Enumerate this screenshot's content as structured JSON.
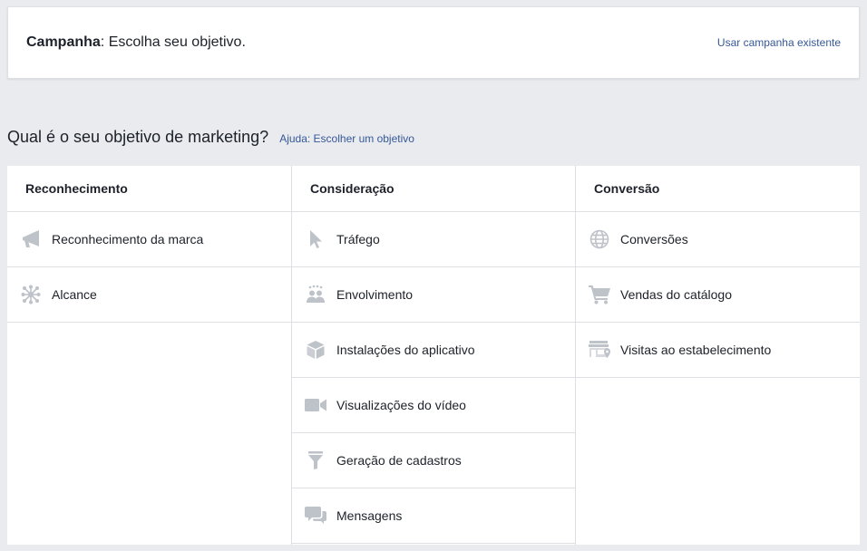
{
  "header": {
    "title_bold": "Campanha",
    "title_rest": ": Escolha seu objetivo.",
    "use_existing_link": "Usar campanha existente"
  },
  "question": {
    "text": "Qual é o seu objetivo de marketing?",
    "help_link": "Ajuda: Escolher um objetivo"
  },
  "icon_color": "#bec2c9",
  "columns": [
    {
      "title": "Reconhecimento",
      "items": [
        {
          "label": "Reconhecimento da marca",
          "icon": "megaphone-icon"
        },
        {
          "label": "Alcance",
          "icon": "reach-icon"
        }
      ]
    },
    {
      "title": "Consideração",
      "items": [
        {
          "label": "Tráfego",
          "icon": "cursor-icon"
        },
        {
          "label": "Envolvimento",
          "icon": "people-icon"
        },
        {
          "label": "Instalações do aplicativo",
          "icon": "box-icon"
        },
        {
          "label": "Visualizações do vídeo",
          "icon": "video-camera-icon"
        },
        {
          "label": "Geração de cadastros",
          "icon": "funnel-icon"
        },
        {
          "label": "Mensagens",
          "icon": "chat-bubbles-icon"
        }
      ]
    },
    {
      "title": "Conversão",
      "items": [
        {
          "label": "Conversões",
          "icon": "globe-icon"
        },
        {
          "label": "Vendas do catálogo",
          "icon": "shopping-cart-icon"
        },
        {
          "label": "Visitas ao estabelecimento",
          "icon": "storefront-icon"
        }
      ]
    }
  ]
}
